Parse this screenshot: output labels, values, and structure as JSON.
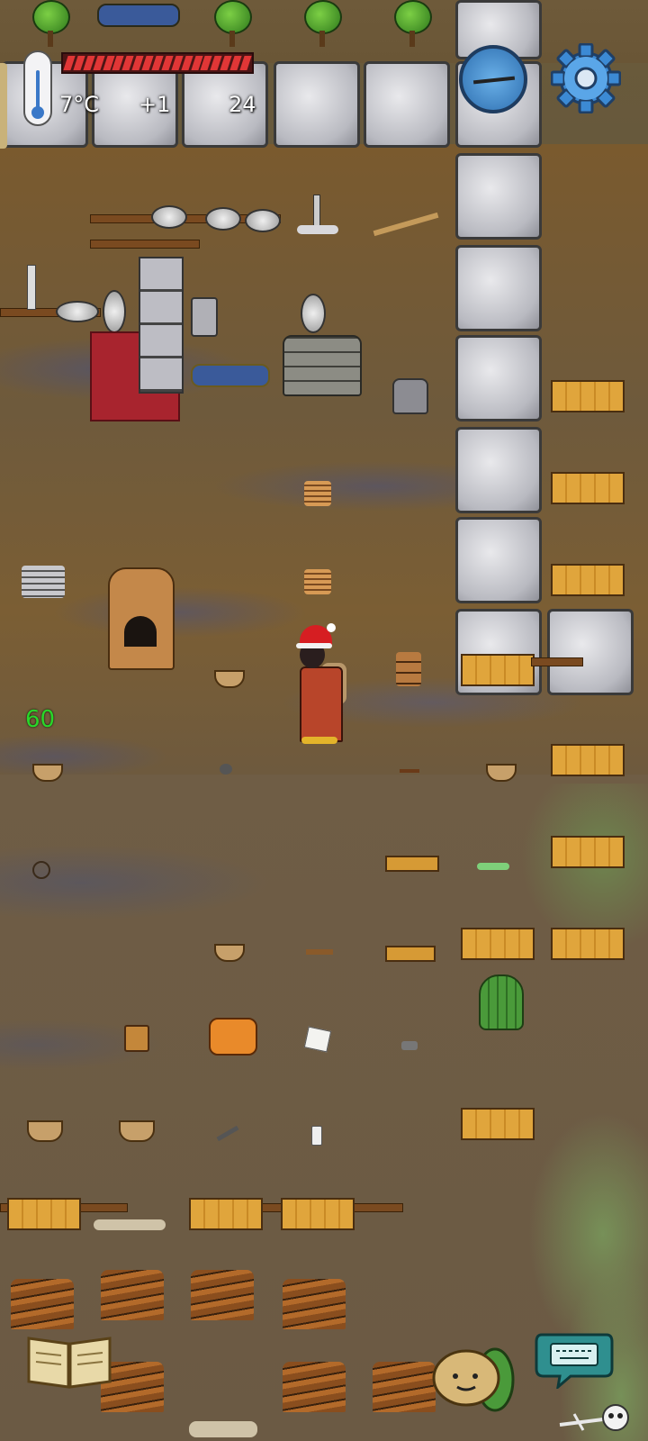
{
  "hud": {
    "temperature": "7°C",
    "temperature_change": "+1",
    "age": "24",
    "food_pips": 19,
    "thermometer_icon": "thermometer-icon",
    "compass_icon": "compass-icon",
    "settings_icon": "gear-icon"
  },
  "debug": {
    "fps": "60"
  },
  "player": {
    "hat": "santa-hat",
    "outfit": "red-robe"
  },
  "controls": {
    "book_icon": "recipe-book-icon",
    "emote_icon": "emote-face-icon",
    "chat_icon": "keyboard-chat-icon"
  },
  "colors": {
    "food_bar": "#e13636",
    "fps_text": "#29d629",
    "hud_text": "#ffffff"
  }
}
